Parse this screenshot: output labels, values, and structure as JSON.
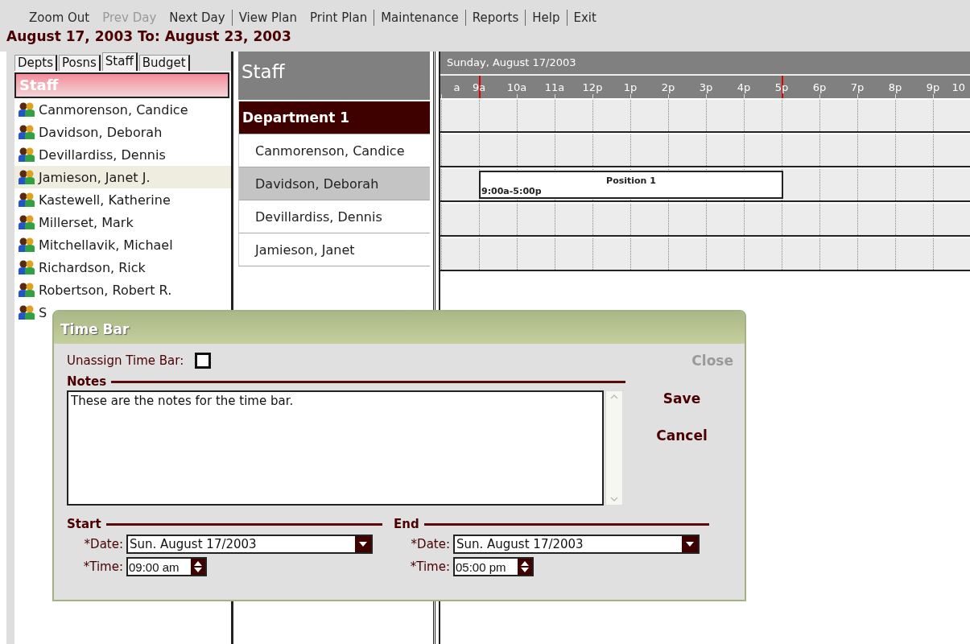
{
  "menu": [
    {
      "label": "Zoom Out",
      "disabled": false,
      "separator_before": false
    },
    {
      "label": "Prev Day",
      "disabled": true,
      "separator_before": false
    },
    {
      "label": "Next Day",
      "disabled": false,
      "separator_before": false
    },
    {
      "label": "View Plan",
      "disabled": false,
      "separator_before": true
    },
    {
      "label": "Print Plan",
      "disabled": false,
      "separator_before": false
    },
    {
      "label": "Maintenance",
      "disabled": false,
      "separator_before": true
    },
    {
      "label": "Reports",
      "disabled": false,
      "separator_before": true
    },
    {
      "label": "Help",
      "disabled": false,
      "separator_before": true
    },
    {
      "label": "Exit",
      "disabled": false,
      "separator_before": true
    }
  ],
  "date_range": "August 17, 2003 To: August 23, 2003",
  "tabs": [
    {
      "label": "Depts",
      "selected": false
    },
    {
      "label": "Posns",
      "selected": false
    },
    {
      "label": "Staff",
      "selected": true
    },
    {
      "label": "Budget",
      "selected": false
    }
  ],
  "staff_list": {
    "header": "Staff",
    "items": [
      {
        "name": "Canmorenson, Candice",
        "selected": false
      },
      {
        "name": "Davidson, Deborah",
        "selected": false
      },
      {
        "name": "Devillardiss, Dennis",
        "selected": false
      },
      {
        "name": "Jamieson, Janet J.",
        "selected": true
      },
      {
        "name": "Kastewell, Katherine",
        "selected": false
      },
      {
        "name": "Millerset, Mark",
        "selected": false
      },
      {
        "name": "Mitchellavik, Michael",
        "selected": false
      },
      {
        "name": "Richardson, Rick",
        "selected": false
      },
      {
        "name": "Robertson, Robert R.",
        "selected": false
      },
      {
        "name": "S",
        "selected": false
      }
    ]
  },
  "schedule": {
    "header": "Staff",
    "day": "Sunday, August 17/2003",
    "hours": [
      {
        "label": "a",
        "marked": false
      },
      {
        "label": "9a",
        "marked": true
      },
      {
        "label": "10a",
        "marked": false
      },
      {
        "label": "11a",
        "marked": false
      },
      {
        "label": "12p",
        "marked": false
      },
      {
        "label": "1p",
        "marked": false
      },
      {
        "label": "2p",
        "marked": false
      },
      {
        "label": "3p",
        "marked": false
      },
      {
        "label": "4p",
        "marked": false
      },
      {
        "label": "5p",
        "marked": true
      },
      {
        "label": "6p",
        "marked": false
      },
      {
        "label": "7p",
        "marked": false
      },
      {
        "label": "8p",
        "marked": false
      },
      {
        "label": "9p",
        "marked": false
      },
      {
        "label": "10",
        "marked": false
      }
    ],
    "rows": [
      {
        "kind": "department",
        "label": "Department 1",
        "selected": false
      },
      {
        "kind": "person",
        "label": "Canmorenson, Candice",
        "selected": false
      },
      {
        "kind": "person",
        "label": "Davidson, Deborah",
        "selected": true,
        "time_bar": {
          "title": "Position 1",
          "time": "9:00a-5:00p"
        }
      },
      {
        "kind": "person",
        "label": "Devillardiss, Dennis",
        "selected": false
      },
      {
        "kind": "person",
        "label": "Jamieson, Janet",
        "selected": false
      }
    ]
  },
  "dialog": {
    "title": "Time Bar",
    "unassign_label": "Unassign Time Bar:",
    "unassign_checked": false,
    "close": "Close",
    "close_disabled": true,
    "notes_label": "Notes",
    "notes": "These are the notes for the time bar.",
    "save": "Save",
    "cancel": "Cancel",
    "groups": [
      {
        "label": "Start",
        "date_label": "*Date:",
        "date": "Sun. August 17/2003",
        "time_label": "*Time:",
        "time": "09:00 am"
      },
      {
        "label": "End",
        "date_label": "*Date:",
        "date": "Sun. August 17/2003",
        "time_label": "*Time:",
        "time": "05:00 pm"
      }
    ]
  }
}
